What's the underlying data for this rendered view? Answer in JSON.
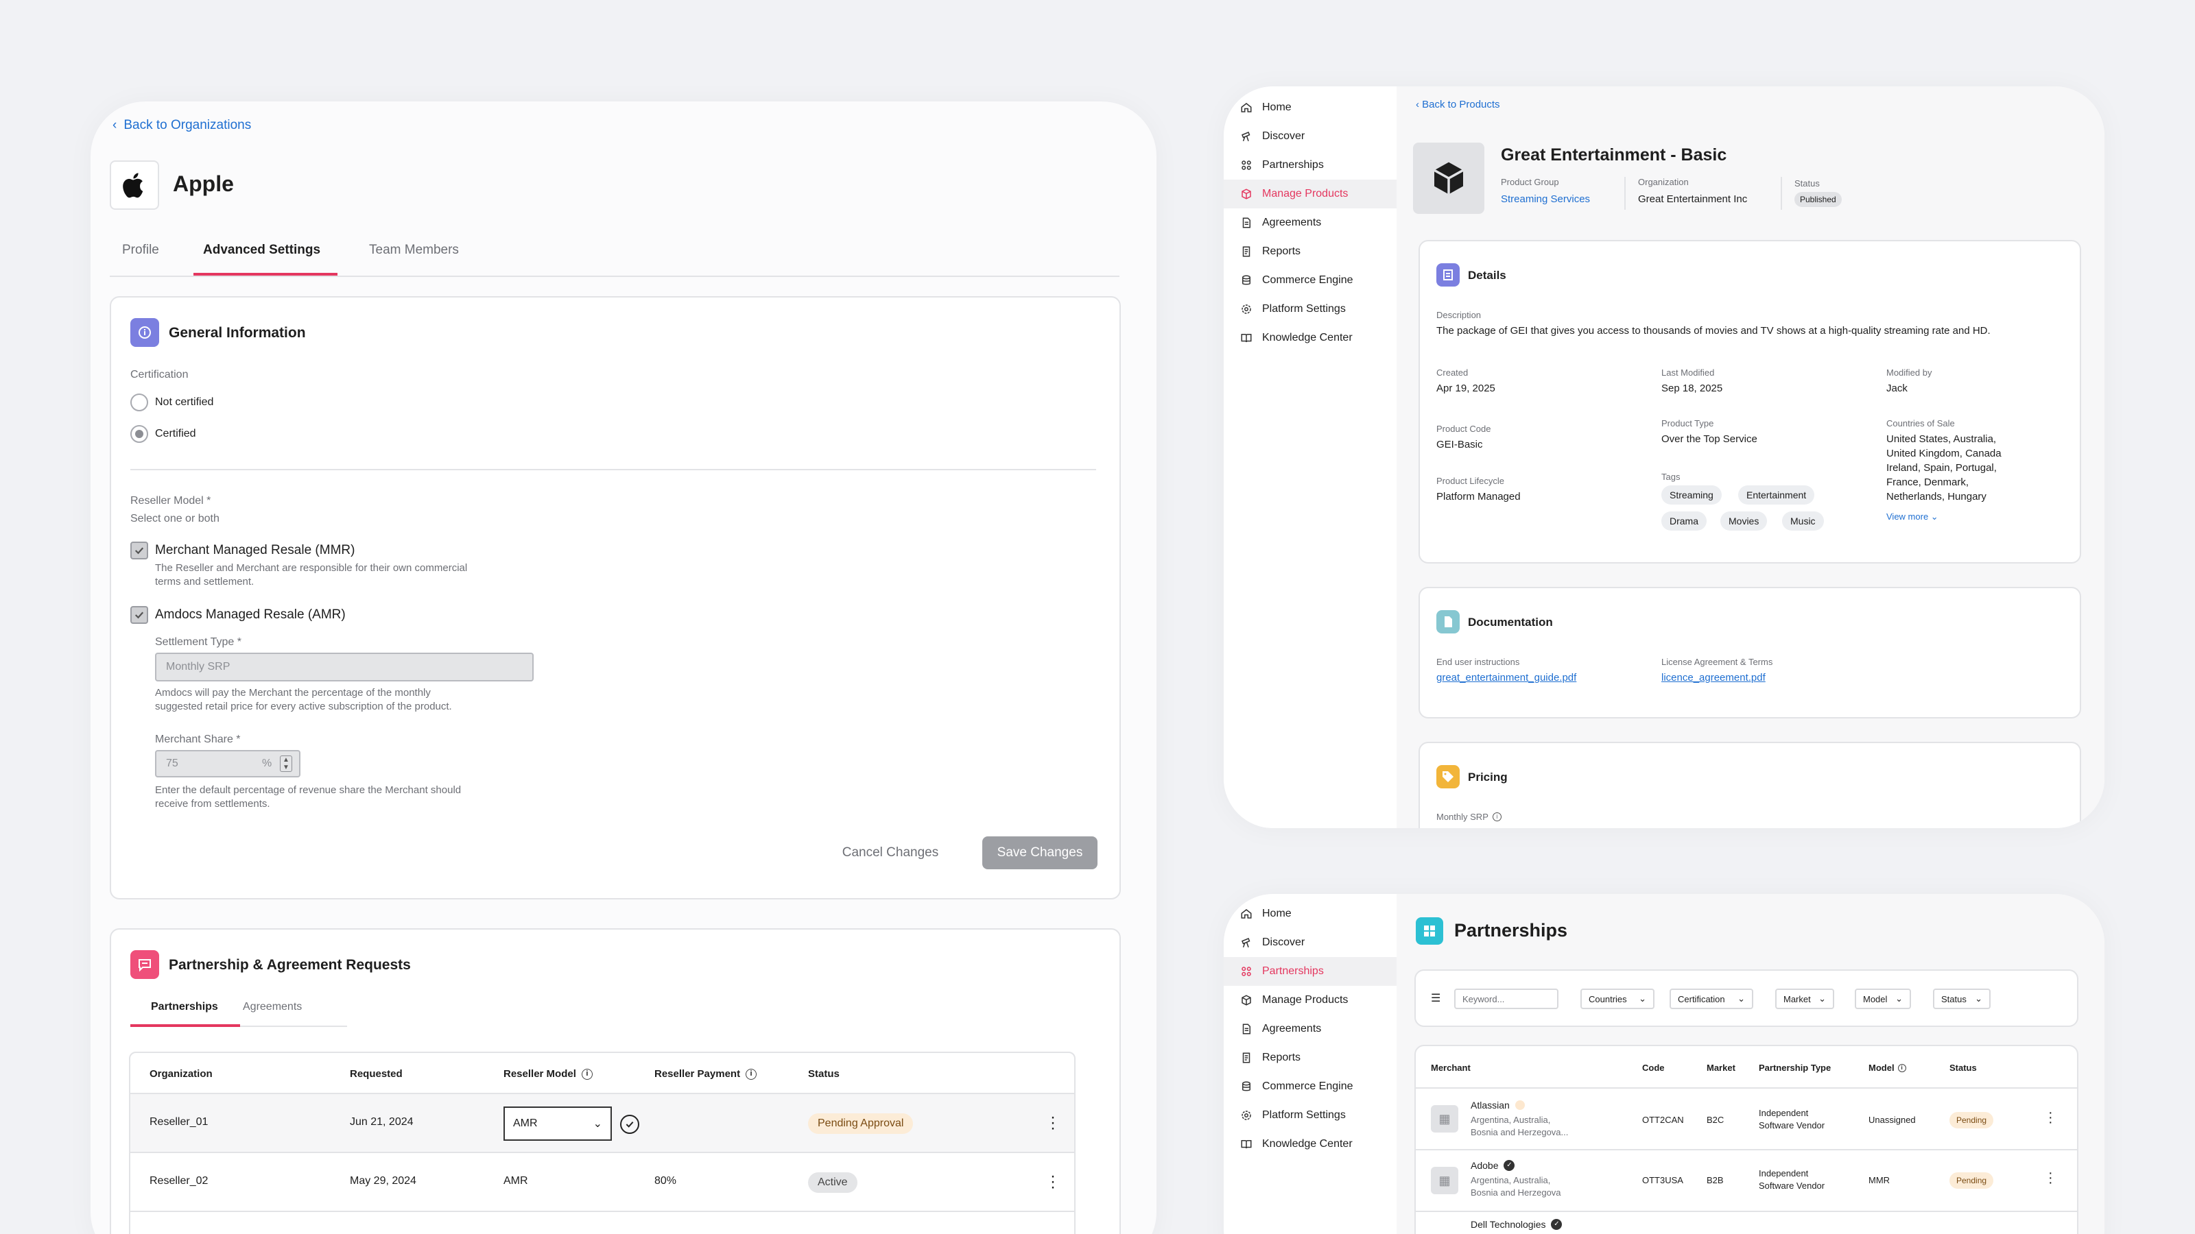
{
  "org": {
    "back_link": "Back to Organizations",
    "name": "Apple",
    "tabs": [
      "Profile",
      "Advanced Settings",
      "Team Members"
    ],
    "general": {
      "title": "General Information",
      "certification_label": "Certification",
      "options": [
        "Not certified",
        "Certified"
      ],
      "selected": "Certified",
      "reseller_model_label": "Reseller Model *",
      "reseller_model_hint": "Select one or both",
      "mmr_label": "Merchant Managed Resale (MMR)",
      "mmr_desc_1": "The Reseller and Merchant are responsible for their own commercial",
      "mmr_desc_2": "terms and settlement.",
      "amr_label": "Amdocs Managed Resale (AMR)",
      "settlement_label": "Settlement Type *",
      "settlement_value": "Monthly SRP",
      "settlement_desc_1": "Amdocs will pay the Merchant the percentage of the monthly",
      "settlement_desc_2": "suggested retail price for every active subscription of the product.",
      "share_label": "Merchant Share *",
      "share_value": "75",
      "share_unit": "%",
      "share_desc_1": "Enter the default percentage of revenue share the Merchant should",
      "share_desc_2": "receive from settlements.",
      "cancel": "Cancel Changes",
      "save": "Save Changes"
    },
    "requests": {
      "title": "Partnership & Agreement Requests",
      "tabs": [
        "Partnerships",
        "Agreements"
      ],
      "columns": [
        "Organization",
        "Requested",
        "Reseller Model",
        "Reseller Payment",
        "Status"
      ],
      "rows": [
        {
          "org": "Reseller_01",
          "requested": "Jun 21, 2024",
          "model": "AMR",
          "payment": "",
          "status": "Pending Approval"
        },
        {
          "org": "Reseller_02",
          "requested": "May 29, 2024",
          "model": "AMR",
          "payment": "80%",
          "status": "Active"
        }
      ]
    }
  },
  "nav": {
    "items": [
      "Home",
      "Discover",
      "Partnerships",
      "Manage Products",
      "Agreements",
      "Reports",
      "Commerce Engine",
      "Platform Settings",
      "Knowledge Center"
    ]
  },
  "product": {
    "back_link": "Back to Products",
    "name": "Great Entertainment - Basic",
    "group_label": "Product Group",
    "group_value": "Streaming Services",
    "org_label": "Organization",
    "org_value": "Great Entertainment Inc",
    "status_label": "Status",
    "status_value": "Published",
    "details": {
      "title": "Details",
      "desc_label": "Description",
      "desc": "The package of GEI that gives you access to thousands of movies and TV shows at a high-quality streaming rate and HD.",
      "created_label": "Created",
      "created": "Apr 19, 2025",
      "modified_label": "Last Modified",
      "modified": "Sep 18, 2025",
      "modby_label": "Modified by",
      "modby": "Jack",
      "code_label": "Product Code",
      "code": "GEI-Basic",
      "type_label": "Product Type",
      "type": "Over the Top Service",
      "countries_label": "Countries of Sale",
      "countries": [
        "United States, Australia,",
        "United Kingdom, Canada",
        "Ireland, Spain, Portugal,",
        "France, Denmark,",
        "Netherlands, Hungary"
      ],
      "lifecycle_label": "Product Lifecycle",
      "lifecycle": "Platform Managed",
      "tags_label": "Tags",
      "tags": [
        "Streaming",
        "Entertainment",
        "Drama",
        "Movies",
        "Music"
      ],
      "view_more": "View more"
    },
    "docs": {
      "title": "Documentation",
      "eui_label": "End user instructions",
      "eui_file": "great_entertainment_guide.pdf",
      "lic_label": "License Agreement & Terms",
      "lic_file": "licence_agreement.pdf"
    },
    "pricing": {
      "title": "Pricing",
      "srp_label": "Monthly SRP"
    }
  },
  "partnerships": {
    "title": "Partnerships",
    "keyword_placeholder": "Keyword...",
    "filters": [
      "Countries",
      "Certification",
      "Market",
      "Model",
      "Status"
    ],
    "columns": [
      "Merchant",
      "Code",
      "Market",
      "Partnership Type",
      "Model",
      "Status"
    ],
    "rows": [
      {
        "name": "Atlassian",
        "countries_1": "Argentina, Australia,",
        "countries_2": "Bosnia and Herzegova...",
        "code": "OTT2CAN",
        "market": "B2C",
        "type_1": "Independent",
        "type_2": "Software Vendor",
        "model": "Unassigned",
        "status": "Pending"
      },
      {
        "name": "Adobe",
        "countries_1": "Argentina, Australia,",
        "countries_2": "Bosnia and Herzegova",
        "code": "OTT3USA",
        "market": "B2B",
        "type_1": "Independent",
        "type_2": "Software Vendor",
        "model": "MMR",
        "status": "Pending"
      },
      {
        "name": "Dell Technologies"
      }
    ]
  },
  "colors": {
    "accent": "#e4375f",
    "link": "#1f6fd1",
    "info_icon": "#7b7fe0",
    "doc_icon": "#86c7d1",
    "pricing_icon": "#f2b53a",
    "partnerships_icon": "#2cc0d3",
    "requests_icon": "#ef4f7a"
  }
}
